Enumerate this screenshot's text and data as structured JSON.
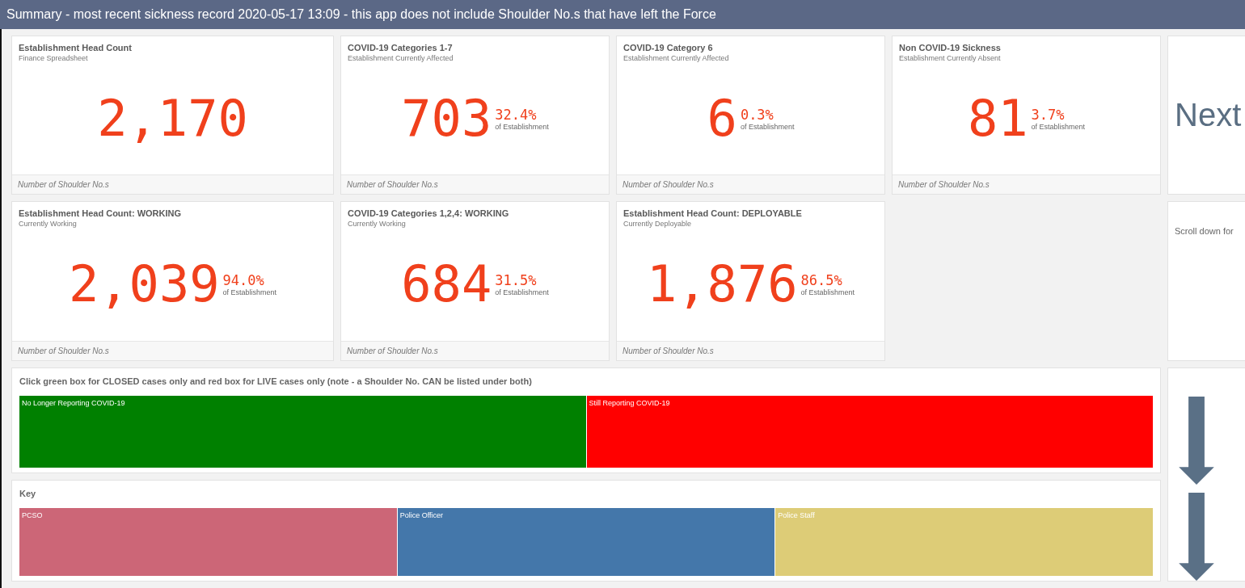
{
  "title_bar": {
    "title": "Summary - most recent sickness record 2020-05-17 13:09 - this app does not include Shoulder No.s that have left the Force"
  },
  "kpi_rows": [
    [
      {
        "title": "Establishment Head Count",
        "subtitle": "Finance Spreadsheet",
        "value": "2,170",
        "footer": "Number of Shoulder No.s"
      },
      {
        "title": "COVID-19 Categories 1-7",
        "subtitle": "Establishment Currently Affected",
        "value": "703",
        "percent": "32.4%",
        "percent_label": "of Establishment",
        "footer": "Number of Shoulder No.s"
      },
      {
        "title": "COVID-19 Category 6",
        "subtitle": "Establishment Currently Affected",
        "value": "6",
        "percent": "0.3%",
        "percent_label": "of Establishment",
        "footer": "Number of Shoulder No.s"
      },
      {
        "title": "Non COVID-19 Sickness",
        "subtitle": "Establishment Currently Absent",
        "value": "81",
        "percent": "3.7%",
        "percent_label": "of Establishment",
        "footer": "Number of Shoulder No.s"
      }
    ],
    [
      {
        "title": "Establishment Head Count: WORKING",
        "subtitle": "Currently Working",
        "value": "2,039",
        "percent": "94.0%",
        "percent_label": "of Establishment",
        "footer": "Number of Shoulder No.s"
      },
      {
        "title": "COVID-19 Categories 1,2,4: WORKING",
        "subtitle": "Currently Working",
        "value": "684",
        "percent": "31.5%",
        "percent_label": "of Establishment",
        "footer": "Number of Shoulder No.s"
      },
      {
        "title": "Establishment Head Count: DEPLOYABLE",
        "subtitle": "Currently Deployable",
        "value": "1,876",
        "percent": "86.5%",
        "percent_label": "of Establishment",
        "footer": "Number of Shoulder No.s"
      }
    ]
  ],
  "status_panel": {
    "title": "Click green box for CLOSED cases only and red box for LIVE cases only (note - a Shoulder No. CAN be listed under both)",
    "blocks": [
      {
        "label": "No Longer Reporting COVID-19",
        "color": "#008000"
      },
      {
        "label": "Still Reporting COVID-19",
        "color": "#ff0000"
      }
    ]
  },
  "key_panel": {
    "title": "Key",
    "blocks": [
      {
        "label": "PCSO",
        "color": "#cc6677"
      },
      {
        "label": "Police Officer",
        "color": "#4477aa"
      },
      {
        "label": "Police Staff",
        "color": "#ddcc77"
      }
    ]
  },
  "side": {
    "next_label": "Next",
    "scroll_text": "Scroll down for"
  }
}
